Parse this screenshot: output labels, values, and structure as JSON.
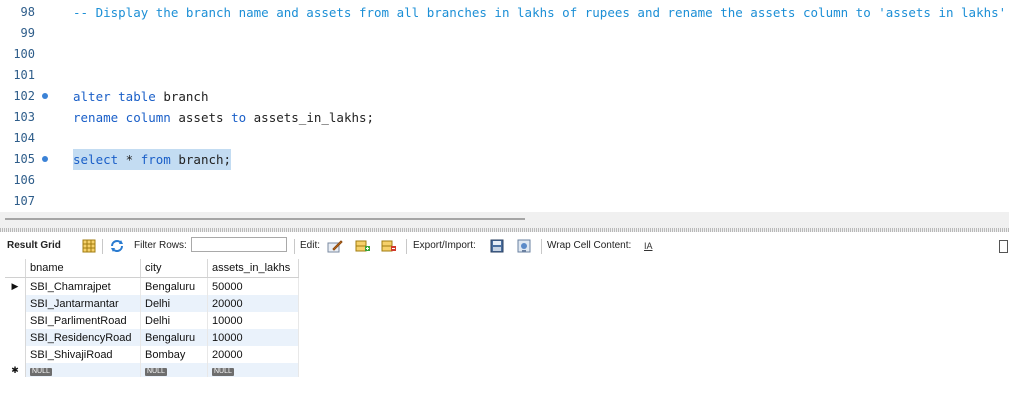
{
  "editor": {
    "lines": [
      {
        "num": "98",
        "bp": false,
        "tokens": [
          {
            "t": "-- Display the branch name and assets from all branches in lakhs of rupees and rename the assets column to 'assets in lakhs'.",
            "c": "comment"
          }
        ]
      },
      {
        "num": "99",
        "bp": false,
        "tokens": []
      },
      {
        "num": "100",
        "bp": false,
        "tokens": []
      },
      {
        "num": "101",
        "bp": false,
        "tokens": []
      },
      {
        "num": "102",
        "bp": true,
        "tokens": [
          {
            "t": "alter table",
            "c": "kw"
          },
          {
            "t": " branch",
            "c": "id"
          }
        ]
      },
      {
        "num": "103",
        "bp": false,
        "tokens": [
          {
            "t": "rename column",
            "c": "kw"
          },
          {
            "t": " assets ",
            "c": "id"
          },
          {
            "t": "to",
            "c": "kw"
          },
          {
            "t": " assets_in_lakhs;",
            "c": "id"
          }
        ]
      },
      {
        "num": "104",
        "bp": false,
        "tokens": []
      },
      {
        "num": "105",
        "bp": true,
        "selected": true,
        "tokens": [
          {
            "t": "select",
            "c": "kw"
          },
          {
            "t": " * ",
            "c": "id"
          },
          {
            "t": "from",
            "c": "kw"
          },
          {
            "t": " branch;",
            "c": "id"
          }
        ]
      },
      {
        "num": "106",
        "bp": false,
        "tokens": []
      },
      {
        "num": "107",
        "bp": false,
        "tokens": []
      }
    ]
  },
  "toolbar": {
    "result_grid": "Result Grid",
    "filter_rows": "Filter Rows:",
    "filter_value": "",
    "edit": "Edit:",
    "export_import": "Export/Import:",
    "wrap": "Wrap Cell Content:",
    "wrap_icon_glyph": "IA"
  },
  "grid": {
    "columns": [
      "bname",
      "city",
      "assets_in_lakhs"
    ],
    "rows": [
      [
        "SBI_Chamrajpet",
        "Bengaluru",
        "50000"
      ],
      [
        "SBI_Jantarmantar",
        "Delhi",
        "20000"
      ],
      [
        "SBI_ParlimentRoad",
        "Delhi",
        "10000"
      ],
      [
        "SBI_ResidencyRoad",
        "Bengaluru",
        "10000"
      ],
      [
        "SBI_ShivajiRoad",
        "Bombay",
        "20000"
      ]
    ],
    "null_label": "NULL",
    "current_marker": "▶",
    "new_marker": "✱"
  },
  "colors": {
    "comment": "#1c8fd6",
    "keyword": "#1a5fc8",
    "selection": "#c3dcf2",
    "alt_row": "#eaf2fb"
  }
}
